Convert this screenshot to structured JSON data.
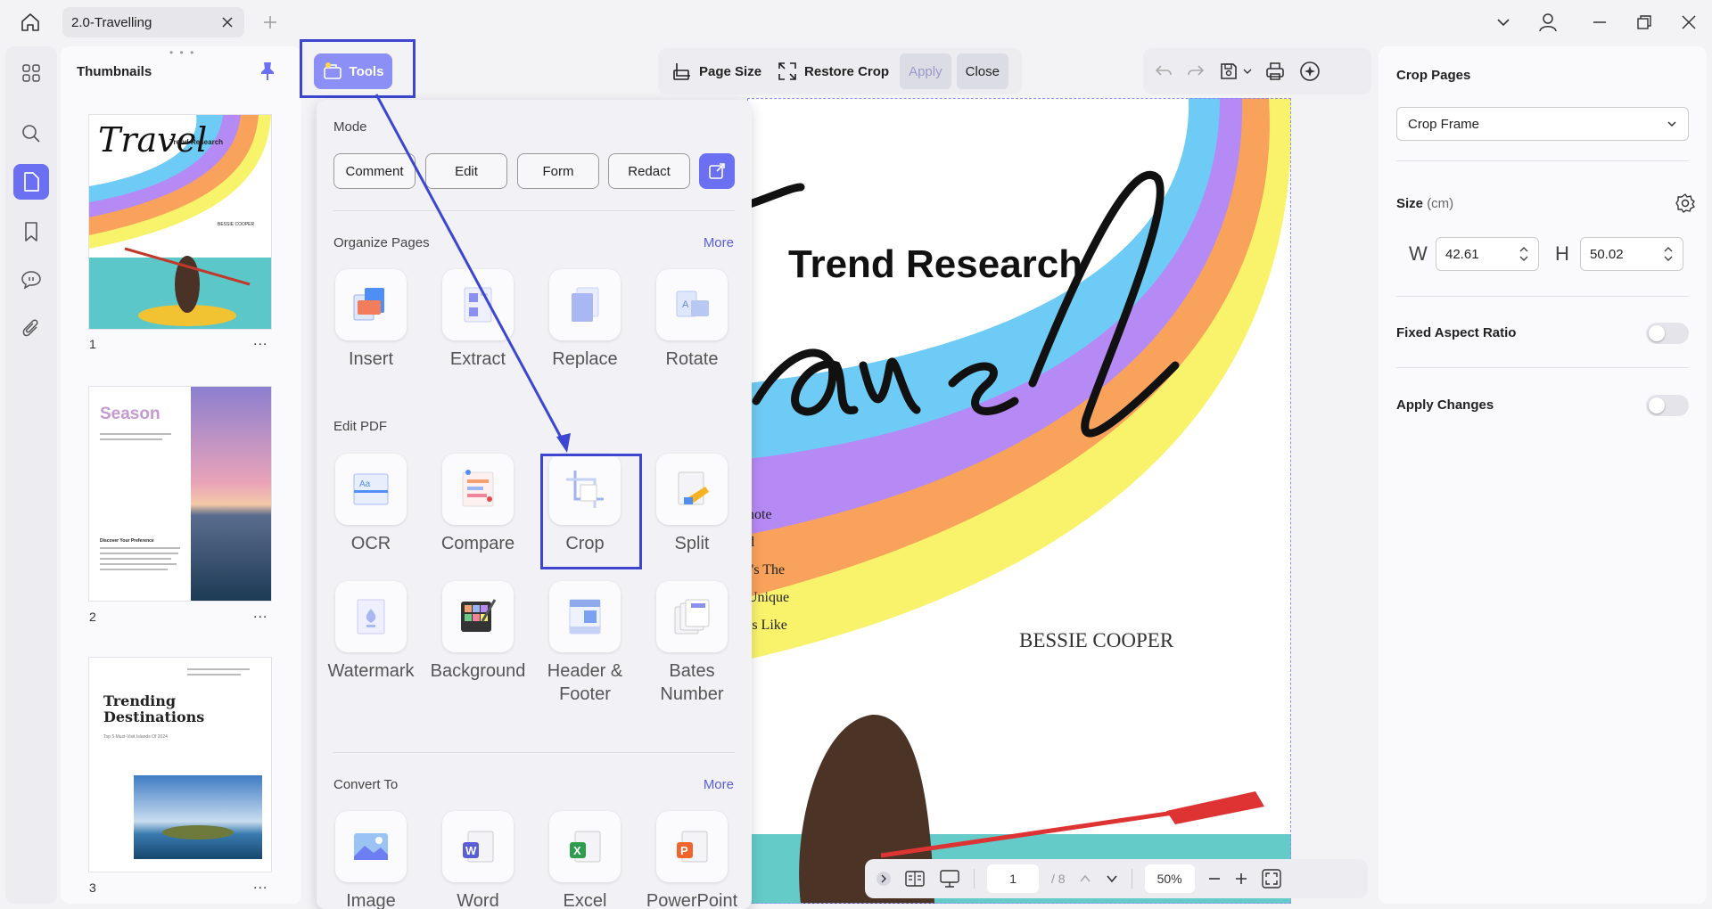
{
  "window": {
    "tab_title": "2.0-Travelling"
  },
  "thumbnails": {
    "title": "Thumbnails",
    "pages": [
      {
        "number": "1",
        "more": "..."
      },
      {
        "number": "2",
        "more": "..."
      },
      {
        "number": "3",
        "more": "..."
      }
    ],
    "page1": {
      "title": "Travel",
      "subtitle": "Trend Research",
      "author": "BESSIE COOPER"
    },
    "page2": {
      "title": "Season",
      "subtitle": "Discover Your Preference"
    },
    "page3": {
      "title_line1": "Trending",
      "title_line2": "Destinations",
      "subtitle": "Top 5 Must-Visit Islands Of 2024"
    }
  },
  "toolbar": {
    "tools_label": "Tools",
    "page_size_label": "Page Size",
    "restore_crop_label": "Restore Crop",
    "apply_label": "Apply",
    "close_label": "Close"
  },
  "tools_panel": {
    "mode_title": "Mode",
    "mode_buttons": [
      "Comment",
      "Edit",
      "Form",
      "Redact"
    ],
    "organize_title": "Organize Pages",
    "organize_more": "More",
    "organize_tools": [
      "Insert",
      "Extract",
      "Replace",
      "Rotate"
    ],
    "edit_title": "Edit PDF",
    "edit_tools": [
      "OCR",
      "Compare",
      "Crop",
      "Split",
      "Watermark",
      "Background",
      "Header & Footer",
      "Bates Number"
    ],
    "convert_title": "Convert To",
    "convert_more": "More",
    "convert_tools": [
      "Image",
      "Word",
      "Excel",
      "PowerPoint"
    ]
  },
  "document": {
    "heading": "Trend Research",
    "script_word": "ravel",
    "side_text": [
      "note",
      "d",
      "t's The",
      "Unique",
      "Is Like"
    ],
    "author": "BESSIE COOPER"
  },
  "bottom_bar": {
    "current_page": "1",
    "total_pages": "/ 8",
    "zoom": "50%"
  },
  "crop_panel": {
    "title": "Crop Pages",
    "frame_select": "Crop Frame",
    "size_label": "Size",
    "size_unit": "(cm)",
    "w_label": "W",
    "w_value": "42.61",
    "h_label": "H",
    "h_value": "50.02",
    "fixed_aspect_label": "Fixed Aspect Ratio",
    "fixed_aspect_on": false,
    "apply_changes_label": "Apply Changes",
    "apply_changes_on": false
  },
  "colors": {
    "accent": "#6b6ff2",
    "highlight": "#3c46d0"
  }
}
